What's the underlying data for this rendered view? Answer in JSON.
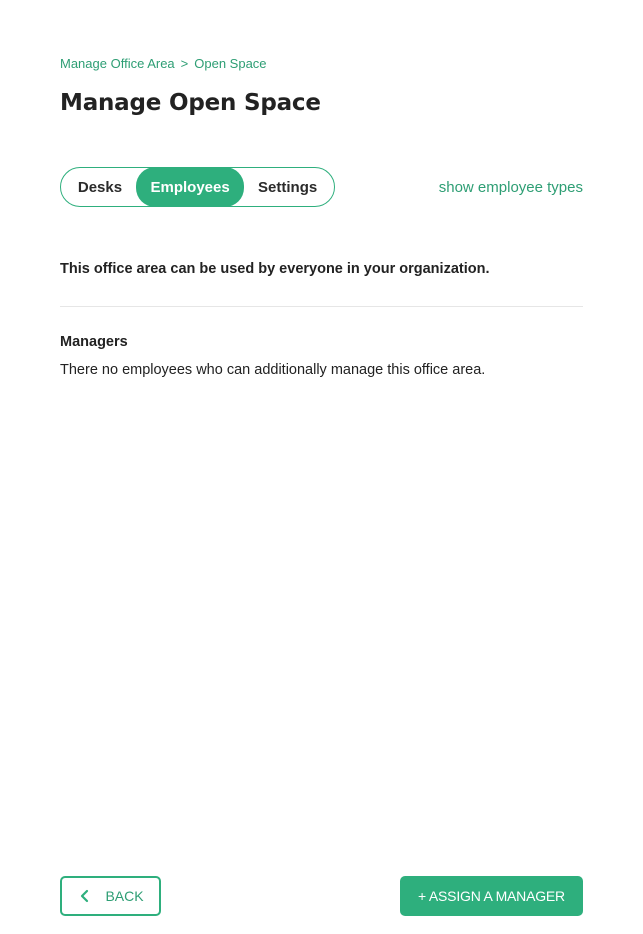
{
  "breadcrumb": {
    "items": [
      "Manage Office Area",
      "Open Space"
    ],
    "separator": ">"
  },
  "page": {
    "title": "Manage Open Space"
  },
  "tabs": {
    "items": [
      {
        "label": "Desks",
        "active": false
      },
      {
        "label": "Employees",
        "active": true
      },
      {
        "label": "Settings",
        "active": false
      }
    ]
  },
  "links": {
    "show_employee_types": "show employee types"
  },
  "content": {
    "availability_text": "This office area can be used by everyone in your organization.",
    "managers_heading": "Managers",
    "managers_empty_text": "There no employees who can additionally manage this office area."
  },
  "footer": {
    "back_label": "BACK",
    "assign_label": "+ ASSIGN A MANAGER"
  },
  "colors": {
    "accent": "#2eaf7d",
    "accent_text": "#2e9e74",
    "text": "#222222",
    "divider": "#e6e6e6"
  },
  "icons": {
    "back": "chevron-left-icon"
  }
}
